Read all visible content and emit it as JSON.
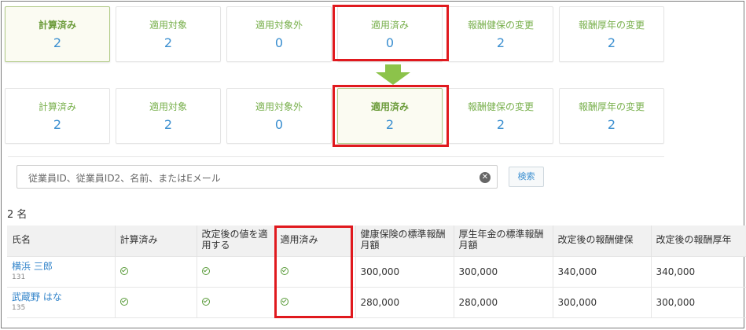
{
  "cards_before": [
    {
      "label": "計算済み",
      "count": "2"
    },
    {
      "label": "適用対象",
      "count": "2"
    },
    {
      "label": "適用対象外",
      "count": "0"
    },
    {
      "label": "適用済み",
      "count": "0"
    },
    {
      "label": "報酬健保の変更",
      "count": "2"
    },
    {
      "label": "報酬厚年の変更",
      "count": "2"
    }
  ],
  "cards_after": [
    {
      "label": "計算済み",
      "count": "2"
    },
    {
      "label": "適用対象",
      "count": "2"
    },
    {
      "label": "適用対象外",
      "count": "0"
    },
    {
      "label": "適用済み",
      "count": "2"
    },
    {
      "label": "報酬健保の変更",
      "count": "2"
    },
    {
      "label": "報酬厚年の変更",
      "count": "2"
    }
  ],
  "colors": {
    "highlight_border": "#e0191e",
    "arrow": "#8cc34a",
    "label_green": "#79b04d",
    "count_blue": "#3b8fd0"
  },
  "search": {
    "placeholder": "従業員ID、従業員ID2、名前、またはEメール",
    "button_label": "検索",
    "clear_icon": "clear-circle-icon"
  },
  "result_count": "2 名",
  "table": {
    "headers": [
      "氏名",
      "計算済み",
      "改定後の値を適用する",
      "適用済み",
      "健康保険の標準報酬月額",
      "厚生年金の標準報酬月額",
      "改定後の報酬健保",
      "改定後の報酬厚年"
    ],
    "rows": [
      {
        "name": "横浜 三郎",
        "code": "131",
        "health": "300,000",
        "pension": "300,000",
        "rev_health": "340,000",
        "rev_pension": "340,000"
      },
      {
        "name": "武蔵野 はな",
        "code": "135",
        "health": "280,000",
        "pension": "280,000",
        "rev_health": "300,000",
        "rev_pension": "300,000"
      }
    ]
  }
}
